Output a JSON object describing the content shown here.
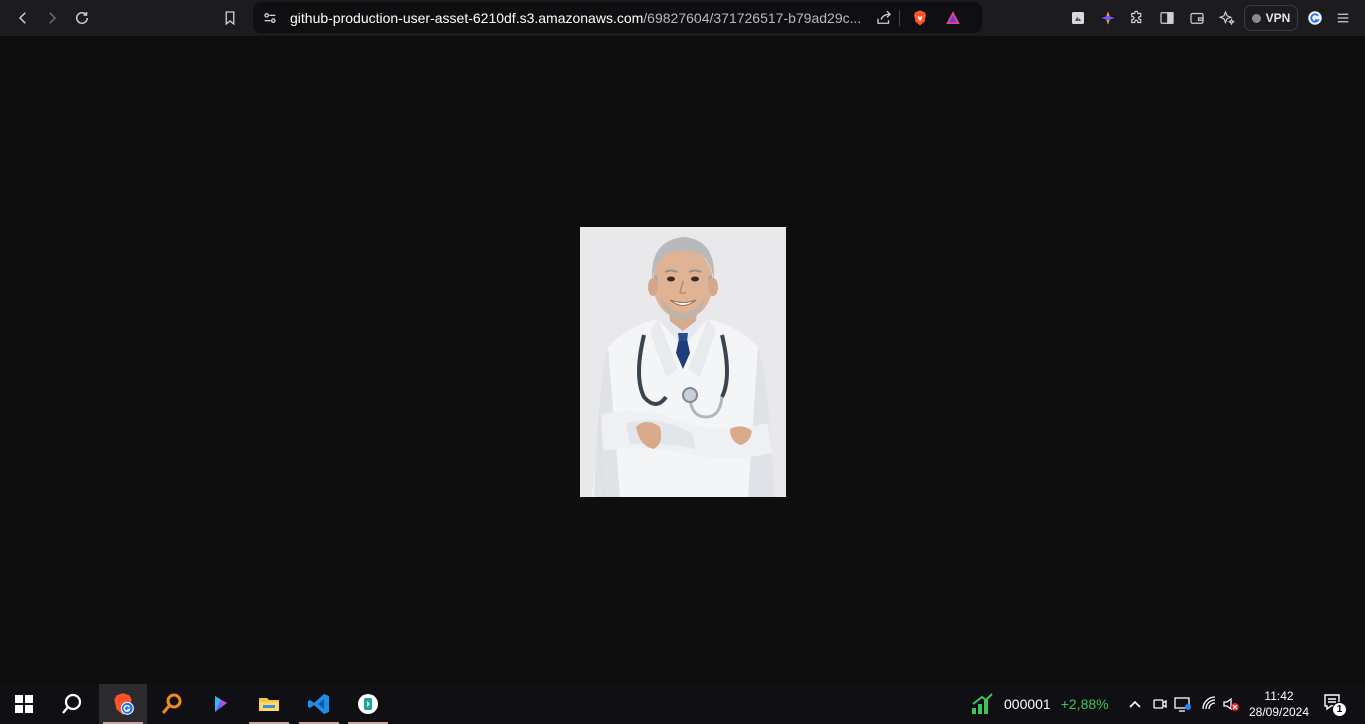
{
  "browser": {
    "url_host": "github-production-user-asset-6210df.s3.amazonaws.com",
    "url_path": "/69827604/371726517-b79ad29c...",
    "vpn_label": "VPN",
    "icons": {
      "back": "chevron-left-icon",
      "forward": "chevron-right-icon",
      "reload": "reload-icon",
      "bookmark": "bookmark-icon",
      "site_info": "site-settings-icon",
      "share": "share-icon",
      "brave_shields": "brave-lion-icon",
      "brave_rewards": "triangle-rewards-icon",
      "extensions": "puzzle-icon",
      "sidebar": "sidebar-icon",
      "wallet": "wallet-icon",
      "leo": "sparkle-icon",
      "menu": "hamburger-icon"
    }
  },
  "content": {
    "image_subject": "doctor-portrait",
    "background_color": "#0e0e0f",
    "image_background": "#e9e9eb"
  },
  "taskbar": {
    "apps": [
      "start",
      "search",
      "brave",
      "magnifier",
      "copilot",
      "file-explorer",
      "vs-code",
      "store"
    ],
    "stock_symbol": "000001",
    "stock_change": "+2,88%",
    "time": "11:42",
    "date": "28/09/2024",
    "notification_count": "1",
    "colors": {
      "stock_up": "#3fc35a",
      "taskbar_bg": "#101014"
    }
  }
}
